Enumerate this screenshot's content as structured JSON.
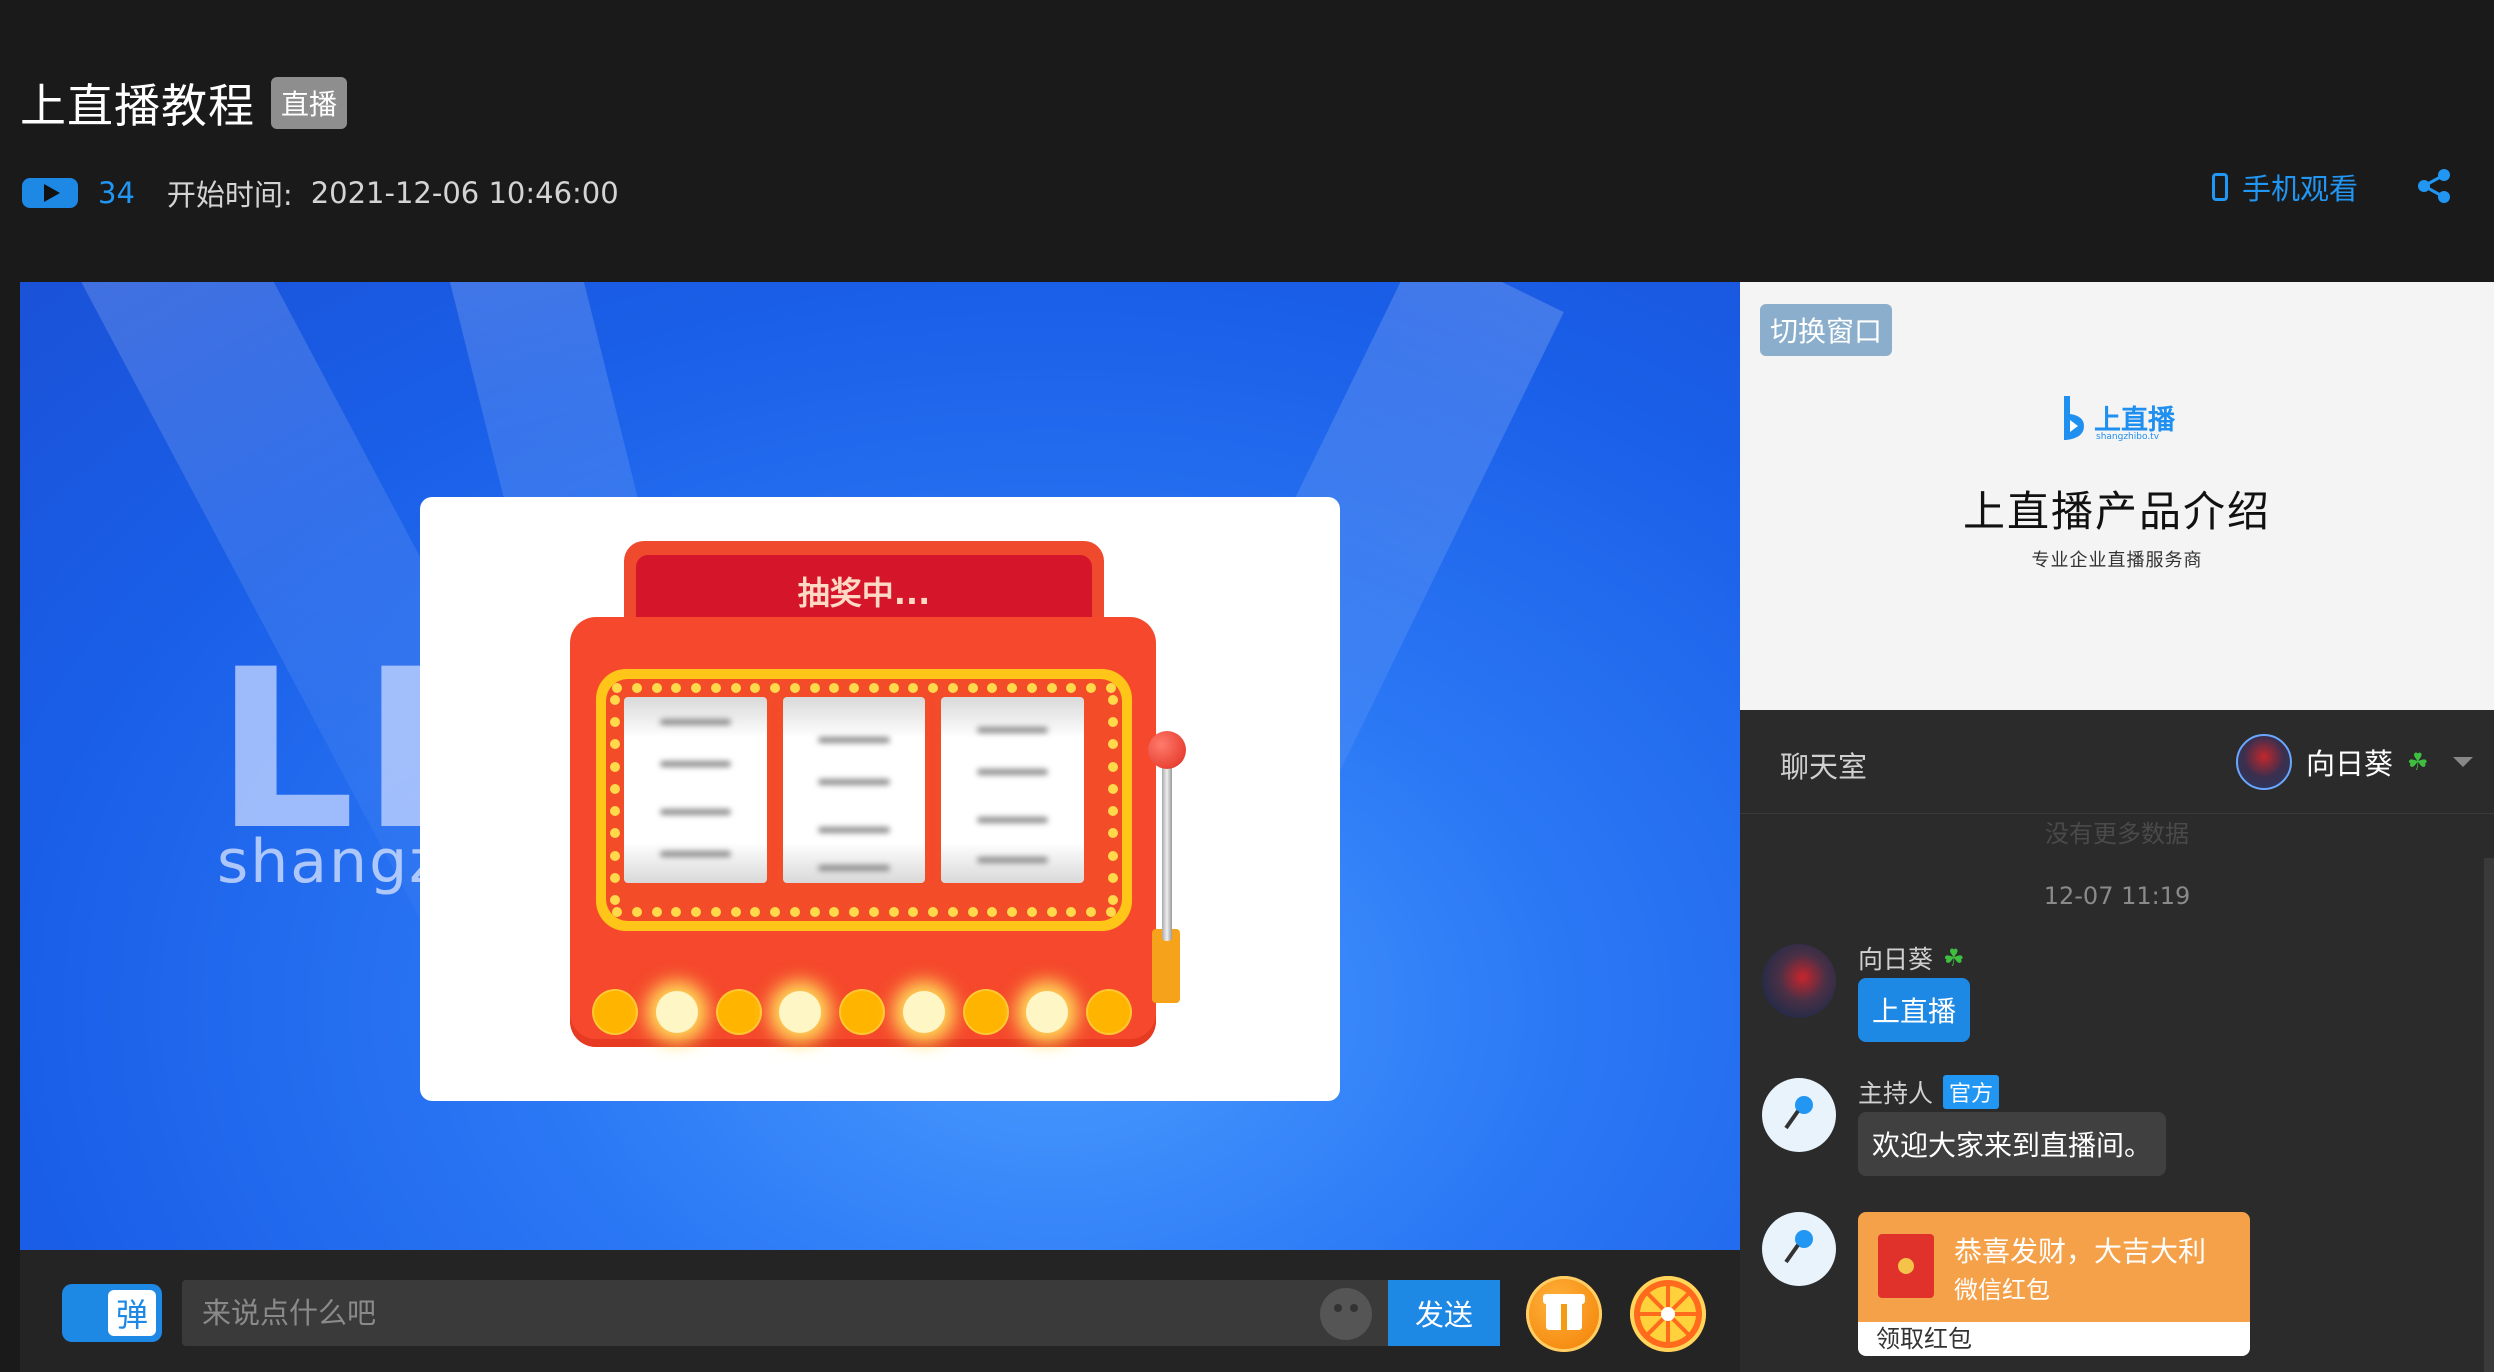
{
  "header": {
    "title": "上直播教程",
    "badge": "直播",
    "viewer_count": "34",
    "start_label": "开始时间:",
    "start_time": "2021-12-06 10:46:00",
    "mobile_watch": "手机观看"
  },
  "video": {
    "bg_text": "LIV",
    "bg_domain": "shangz",
    "lottery": {
      "status": "抽奖中..."
    }
  },
  "input_bar": {
    "danmu_label": "弹",
    "placeholder": "来说点什么吧",
    "send_label": "发送"
  },
  "slide": {
    "switch_label": "切换窗口",
    "logo_text": "上直播",
    "logo_sub": "shangzhibo.tv",
    "title": "上直播产品介绍",
    "subtitle": "专业企业直播服务商"
  },
  "chat": {
    "title": "聊天室",
    "current_user": "向日葵",
    "no_more": "没有更多数据",
    "time": "12-07 11:19",
    "messages": [
      {
        "name": "向日葵",
        "text": "上直播"
      },
      {
        "name": "主持人",
        "badge": "官方",
        "text": "欢迎大家来到直播间。"
      },
      {
        "title": "恭喜发财，大吉大利",
        "sub": "微信红包",
        "action": "领取红包"
      }
    ]
  },
  "colors": {
    "accent": "#1e88e5",
    "header_bg": "#1a1a1a",
    "chat_bg": "#2b2b2b",
    "red_packet": "#f5a14a"
  }
}
